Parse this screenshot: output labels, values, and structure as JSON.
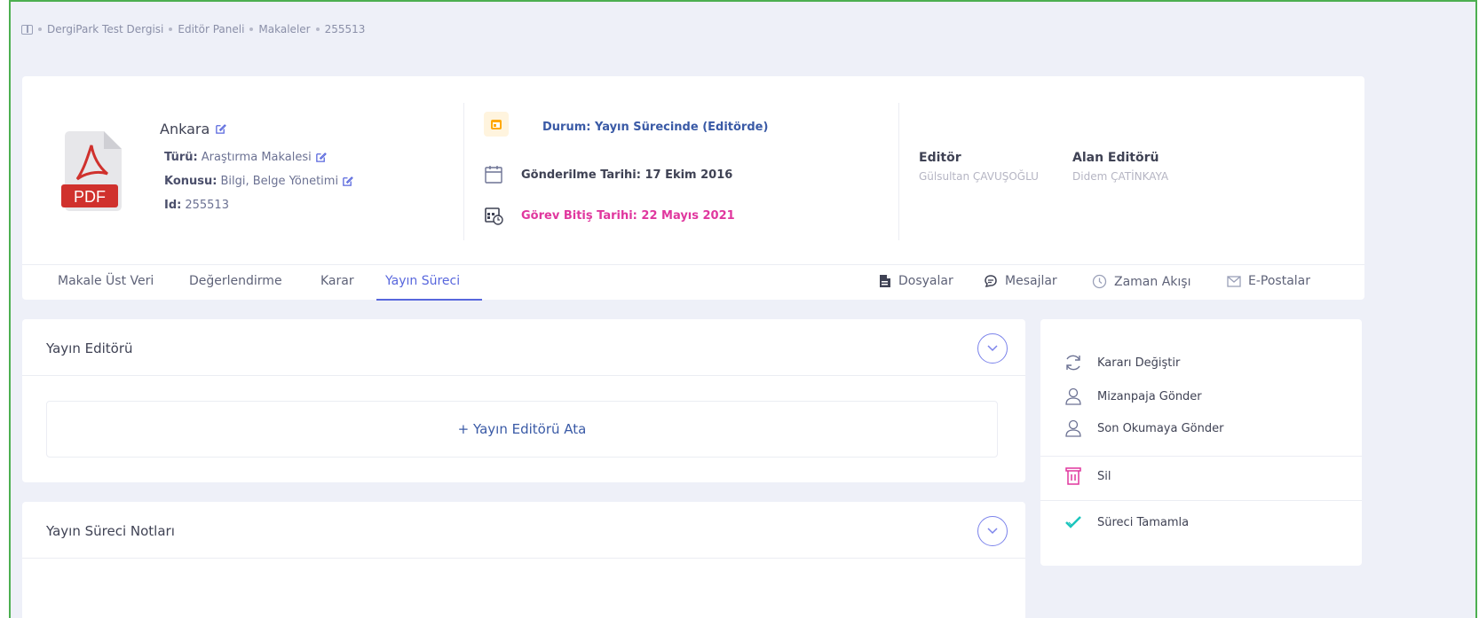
{
  "breadcrumb": {
    "items": [
      "DergiPark Test Dergisi",
      "Editör Paneli",
      "Makaleler",
      "255513"
    ]
  },
  "article": {
    "title": "Ankara",
    "type_label": "Türü:",
    "type_value": "Araştırma Makalesi",
    "subject_label": "Konusu:",
    "subject_value": "Bilgi, Belge Yönetimi",
    "id_label": "Id:",
    "id_value": "255513",
    "pdf_label": "PDF"
  },
  "status": {
    "text": "Durum: Yayın Sürecinde (Editörde)",
    "sent_date": "Gönderilme Tarihi: 17 Ekim 2016",
    "due_date": "Görev Bitiş Tarihi: 22 Mayıs 2021"
  },
  "editors": {
    "editor_label": "Editör",
    "editor_name": "Gülsultan ÇAVUŞOĞLU",
    "field_editor_label": "Alan Editörü",
    "field_editor_name": "Didem ÇATİNKAYA"
  },
  "tabs": {
    "left": [
      "Makale Üst Veri",
      "Değerlendirme",
      "Karar",
      "Yayın Süreci"
    ],
    "active": "Yayın Süreci",
    "right": [
      "Dosyalar",
      "Mesajlar",
      "Zaman Akışı",
      "E-Postalar"
    ]
  },
  "panels": {
    "publication_editor_title": "Yayın Editörü",
    "assign_label": "+ Yayın Editörü Ata",
    "notes_title": "Yayın Süreci Notları"
  },
  "actions": {
    "change_decision": "Kararı Değiştir",
    "send_layout": "Mizanpaja Gönder",
    "send_proofread": "Son Okumaya Gönder",
    "delete": "Sil",
    "complete": "Süreci Tamamla"
  },
  "colors": {
    "accent": "#5867dd",
    "link_blue": "#3a5aa6",
    "due_pink": "#e0379e",
    "delete_red": "#e0379e",
    "complete_green": "#1bc5bd",
    "pdf_red": "#d0312d"
  }
}
